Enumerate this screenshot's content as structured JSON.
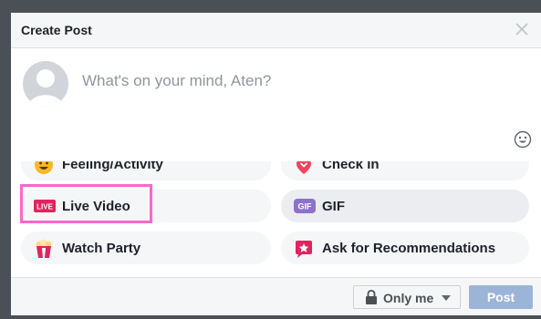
{
  "dialog": {
    "title": "Create Post",
    "close_icon": "close-icon"
  },
  "composer": {
    "placeholder": "What's on your mind, Aten?",
    "avatar_icon": "default-avatar-icon",
    "emoji_icon": "emoji-icon"
  },
  "options": [
    {
      "label": "Feeling/Activity",
      "icon": "smiley-icon"
    },
    {
      "label": "Check in",
      "icon": "location-pin-icon"
    },
    {
      "label": "Live Video",
      "icon": "live-video-icon",
      "badge": "LIVE"
    },
    {
      "label": "GIF",
      "icon": "gif-icon",
      "badge": "GIF"
    },
    {
      "label": "Watch Party",
      "icon": "popcorn-icon"
    },
    {
      "label": "Ask for Recommendations",
      "icon": "recommendation-star-icon"
    }
  ],
  "footer": {
    "privacy_label": "Only me",
    "post_label": "Post"
  },
  "colors": {
    "frame": "#4b4f56",
    "highlight": "#ff66cc",
    "post_disabled": "#9cb4d8",
    "live_red": "#e0245e",
    "gif_purple": "#8c72cb"
  }
}
